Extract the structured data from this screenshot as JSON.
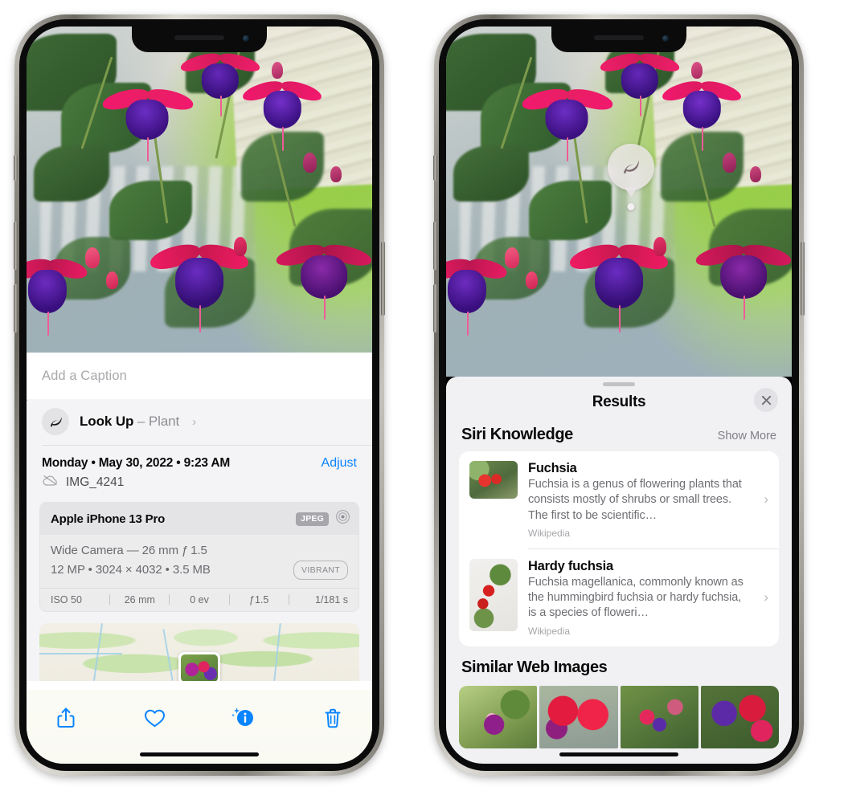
{
  "left_phone": {
    "caption_placeholder": "Add a Caption",
    "lookup": {
      "label": "Look Up",
      "dash": "–",
      "subject": "Plant",
      "chevron": "›",
      "icon": "leaf-icon"
    },
    "date_line": "Monday • May 30, 2022 • 9:23 AM",
    "adjust_label": "Adjust",
    "file_name": "IMG_4241",
    "cloud_icon": "cloud-slash-icon",
    "metadata": {
      "device": "Apple iPhone 13 Pro",
      "format_badge": "JPEG",
      "hdr_icon": "aperture-icon",
      "lens_line": "Wide Camera — 26 mm ƒ 1.5",
      "spec_line": "12 MP • 3024 × 4032 • 3.5 MB",
      "style_pill": "VIBRANT",
      "exif": [
        "ISO 50",
        "26 mm",
        "0 ev",
        "ƒ1.5",
        "1/181 s"
      ]
    },
    "toolbar": [
      {
        "name": "share-button",
        "icon": "share-icon"
      },
      {
        "name": "favorite-button",
        "icon": "heart-icon"
      },
      {
        "name": "info-button",
        "icon": "info-sparkle-icon"
      },
      {
        "name": "delete-button",
        "icon": "trash-icon"
      }
    ],
    "accent_color": "#0a84ff"
  },
  "right_phone": {
    "visual_lookup_badge": {
      "icon": "leaf-icon"
    },
    "sheet": {
      "title": "Results",
      "close_icon": "close-icon",
      "siri_knowledge": {
        "heading": "Siri Knowledge",
        "show_more": "Show More",
        "items": [
          {
            "title": "Fuchsia",
            "description": "Fuchsia is a genus of flowering plants that consists mostly of shrubs or small trees. The first to be scientific…",
            "source": "Wikipedia",
            "chevron": "›"
          },
          {
            "title": "Hardy fuchsia",
            "description": "Fuchsia magellanica, commonly known as the hummingbird fuchsia or hardy fuchsia, is a species of floweri…",
            "source": "Wikipedia",
            "chevron": "›"
          }
        ]
      },
      "similar_web_images": {
        "heading": "Similar Web Images",
        "thumbnails": [
          "web-image-1",
          "web-image-2",
          "web-image-3",
          "web-image-4"
        ]
      }
    }
  }
}
